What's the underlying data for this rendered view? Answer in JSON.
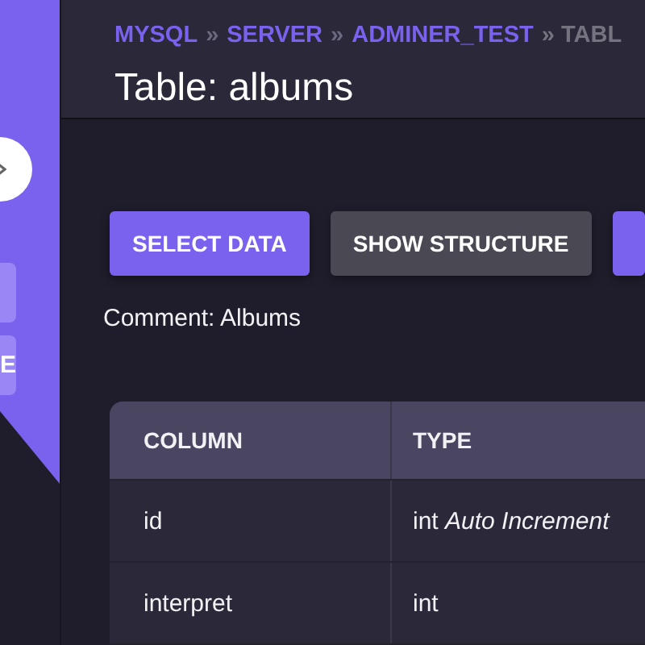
{
  "sidebar": {
    "items": [
      {
        "label": "E"
      }
    ]
  },
  "breadcrumb": [
    {
      "label": "MYSQL",
      "kind": "link"
    },
    {
      "label": "»",
      "kind": "sep"
    },
    {
      "label": "SERVER",
      "kind": "link"
    },
    {
      "label": "»",
      "kind": "sep"
    },
    {
      "label": "ADMINER_TEST",
      "kind": "link"
    },
    {
      "label": "» TABL",
      "kind": "current"
    }
  ],
  "title": "Table: albums",
  "buttons": [
    {
      "label": "SELECT DATA",
      "kind": "primary"
    },
    {
      "label": "SHOW STRUCTURE",
      "kind": "secondary"
    },
    {
      "kind": "primary"
    }
  ],
  "comment": "Comment: Albums",
  "table": {
    "columns": [
      "COLUMN",
      "TYPE"
    ],
    "rows": [
      {
        "cells": [
          "id",
          "int *Auto Increment*"
        ]
      },
      {
        "cells": [
          "interpret",
          "int"
        ]
      }
    ]
  }
}
